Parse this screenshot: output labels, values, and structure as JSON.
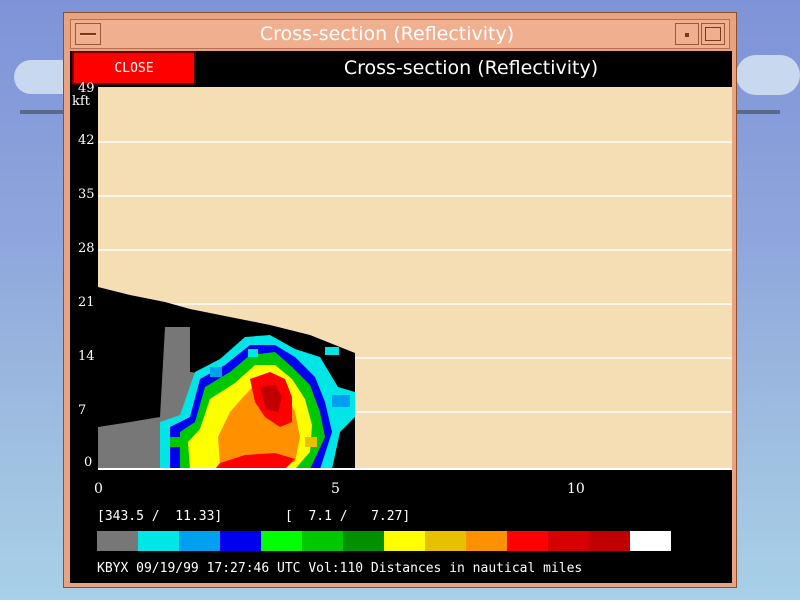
{
  "window": {
    "title": "Cross-section (Reflectivity)"
  },
  "header": {
    "close_label": "CLOSE",
    "title": "Cross-section (Reflectivity)"
  },
  "plot": {
    "y_unit": "kft",
    "y_top_label": "49",
    "y_ticks": [
      "42",
      "35",
      "28",
      "21",
      "14",
      "7",
      "0"
    ],
    "x_ticks": [
      "0",
      "5",
      "10"
    ],
    "background_color": "#f5deb3",
    "gridline_color": "#ffffff"
  },
  "readout": {
    "left": "[343.5 /  11.33]",
    "right": "[  7.1 /   7.27]"
  },
  "colorbar": {
    "colors": [
      "#777777",
      "#00e5e5",
      "#00a0f0",
      "#0000f0",
      "#00ff00",
      "#00c800",
      "#009000",
      "#ffff00",
      "#e7c000",
      "#ff9000",
      "#ff0000",
      "#d60000",
      "#c00000",
      "#ffffff"
    ]
  },
  "status": {
    "text": "KBYX 09/19/99 17:27:46 UTC Vol:110 Distances in nautical miles"
  }
}
